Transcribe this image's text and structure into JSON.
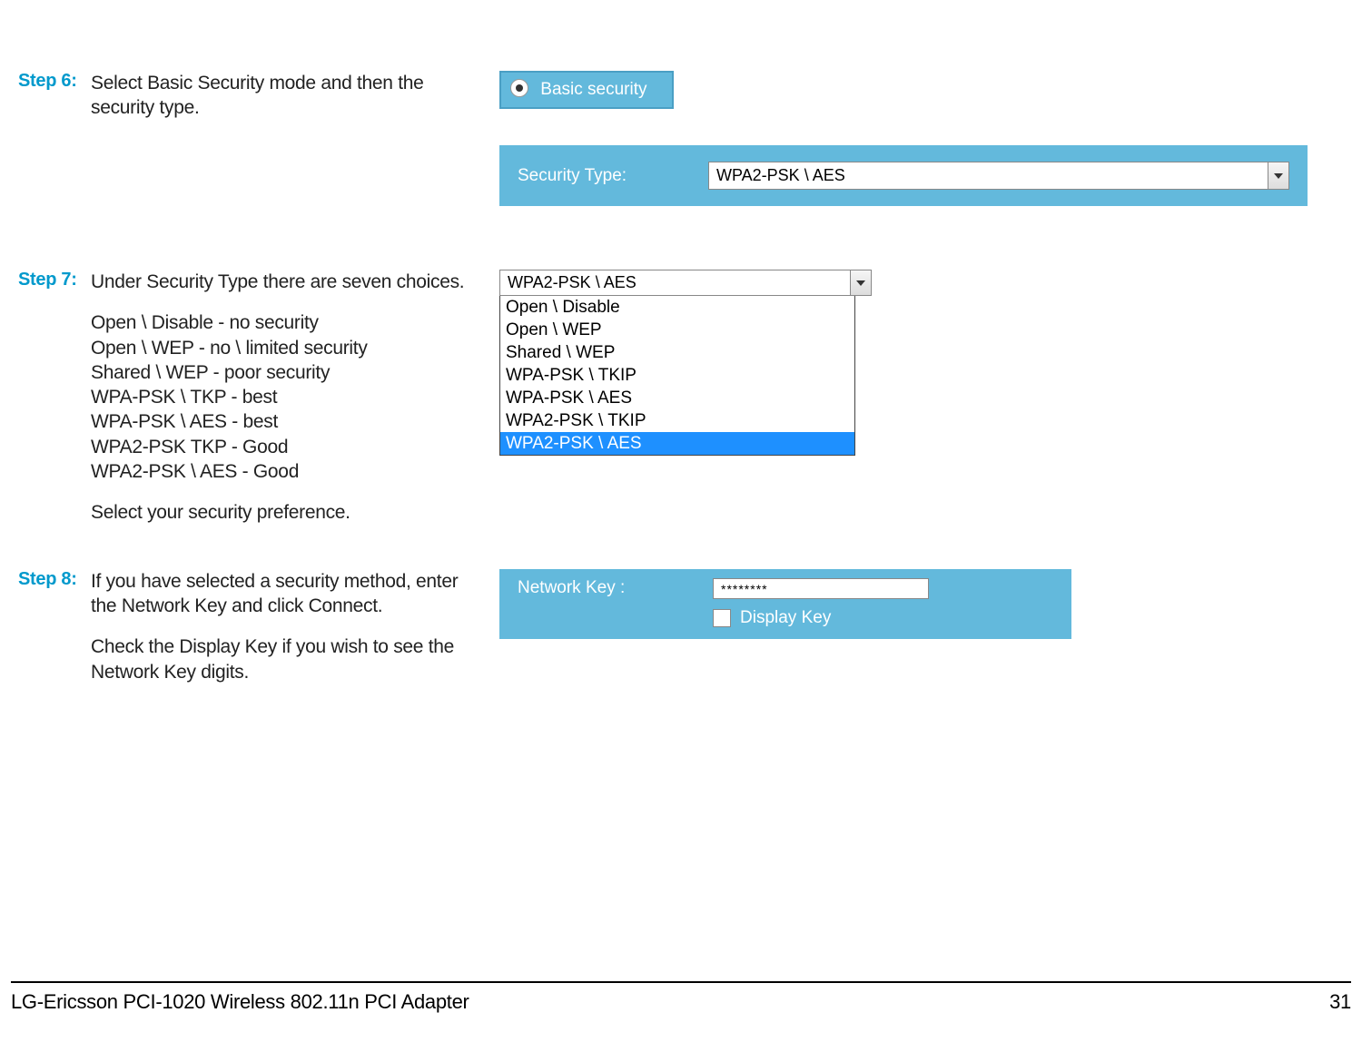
{
  "step6": {
    "label": "Step 6:",
    "text1": "Select Basic Security mode and then the security type.",
    "basic_security_label": "Basic security",
    "security_type_label": "Security Type:",
    "security_type_value": "WPA2-PSK \\ AES"
  },
  "step7": {
    "label": "Step 7:",
    "intro": "Under Security Type there are seven choices.",
    "choice1": "Open \\ Disable - no security",
    "choice2": "Open \\ WEP - no \\ limited security",
    "choice3": "Shared \\ WEP - poor security",
    "choice4": "WPA-PSK \\ TKP - best",
    "choice5": "WPA-PSK \\ AES - best",
    "choice6": "WPA2-PSK TKP - Good",
    "choice7": "WPA2-PSK \\ AES - Good",
    "outro": "Select your security preference.",
    "dropdown_value": "WPA2-PSK \\ AES",
    "opt1": "Open \\ Disable",
    "opt2": "Open \\ WEP",
    "opt3": "Shared \\ WEP",
    "opt4": "WPA-PSK \\ TKIP",
    "opt5": "WPA-PSK \\ AES",
    "opt6": "WPA2-PSK \\ TKIP",
    "opt7": "WPA2-PSK \\ AES"
  },
  "step8": {
    "label": "Step 8:",
    "text1": "If you have selected a security method, enter the Network Key and click Connect.",
    "text2": "Check the Display Key if you wish to see the Network Key digits.",
    "network_key_label": "Network Key :",
    "network_key_value": "********",
    "display_key_label": "Display Key"
  },
  "footer": {
    "left": "LG-Ericsson PCI-1020 Wireless 802.11n PCI Adapter",
    "right": "31"
  }
}
